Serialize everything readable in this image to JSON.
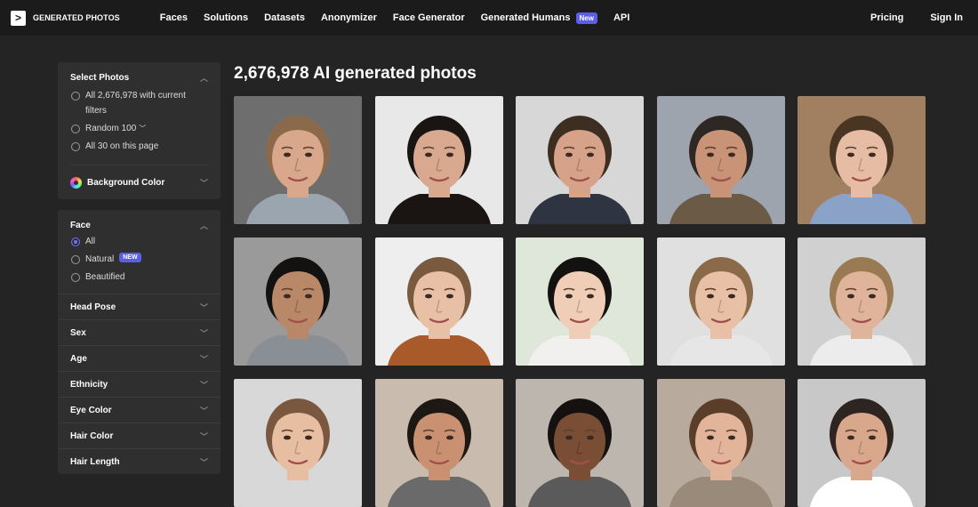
{
  "brand": {
    "logo_glyph": ">",
    "name": "GENERATED PHOTOS"
  },
  "nav": {
    "items": [
      "Faces",
      "Solutions",
      "Datasets",
      "Anonymizer",
      "Face Generator",
      "Generated Humans",
      "API"
    ],
    "new_badge": "New",
    "pricing": "Pricing",
    "signin": "Sign In"
  },
  "sidebar": {
    "select_photos": {
      "title": "Select Photos",
      "options": [
        "All 2,676,978 with current filters",
        "Random 100",
        "All 30 on this page"
      ]
    },
    "background_color": "Background Color",
    "face": {
      "title": "Face",
      "options": [
        "All",
        "Natural",
        "Beautified"
      ],
      "new_label": "NEW"
    },
    "filters": [
      "Head Pose",
      "Sex",
      "Age",
      "Ethnicity",
      "Eye Color",
      "Hair Color",
      "Hair Length"
    ]
  },
  "main": {
    "title": "2,676,978 AI generated photos"
  },
  "colors": {
    "accent": "#5b5fe8",
    "background": "#242424",
    "panel": "#2f2f2f",
    "topbar": "#1b1b1b"
  },
  "photos": [
    {
      "bg": "#6e6e6e",
      "skin": "#d9a78b",
      "hair": "#8a6a4a",
      "shirt": "#9aa5b0"
    },
    {
      "bg": "#e8e8e8",
      "skin": "#d8a88f",
      "hair": "#1a1412",
      "shirt": "#1a1412"
    },
    {
      "bg": "#d7d7d7",
      "skin": "#d6a289",
      "hair": "#3e2e22",
      "shirt": "#2e3442"
    },
    {
      "bg": "#9da4ad",
      "skin": "#c99378",
      "hair": "#2e2824",
      "shirt": "#6b5a46"
    },
    {
      "bg": "#a08060",
      "skin": "#e6bca4",
      "hair": "#4a3422",
      "shirt": "#8ba2c8"
    },
    {
      "bg": "#9a9a9a",
      "skin": "#b98868",
      "hair": "#141210",
      "shirt": "#8a8f96"
    },
    {
      "bg": "#eeeeee",
      "skin": "#e8c0a6",
      "hair": "#7a5a3e",
      "shirt": "#a85a2a"
    },
    {
      "bg": "#dfe6da",
      "skin": "#f0cdb6",
      "hair": "#141210",
      "shirt": "#f2f0ee"
    },
    {
      "bg": "#e0e0e0",
      "skin": "#e8c0a6",
      "hair": "#8a6a48",
      "shirt": "#e6e6e6"
    },
    {
      "bg": "#d0d0d0",
      "skin": "#e0b49a",
      "hair": "#9a7a52",
      "shirt": "#ececec"
    },
    {
      "bg": "#d8d8d8",
      "skin": "#e8bea2",
      "hair": "#7a5840",
      "shirt": "#d8d8d8"
    },
    {
      "bg": "#c9bcae",
      "skin": "#c99172",
      "hair": "#1e1814",
      "shirt": "#6a6a6a"
    },
    {
      "bg": "#bdb6ae",
      "skin": "#7a4e34",
      "hair": "#141110",
      "shirt": "#5a5a5a"
    },
    {
      "bg": "#b8aa9c",
      "skin": "#e2b49a",
      "hair": "#5a3e2a",
      "shirt": "#9a8a7a"
    },
    {
      "bg": "#c8c8c8",
      "skin": "#d9a88c",
      "hair": "#2e2420",
      "shirt": "#ffffff"
    }
  ]
}
